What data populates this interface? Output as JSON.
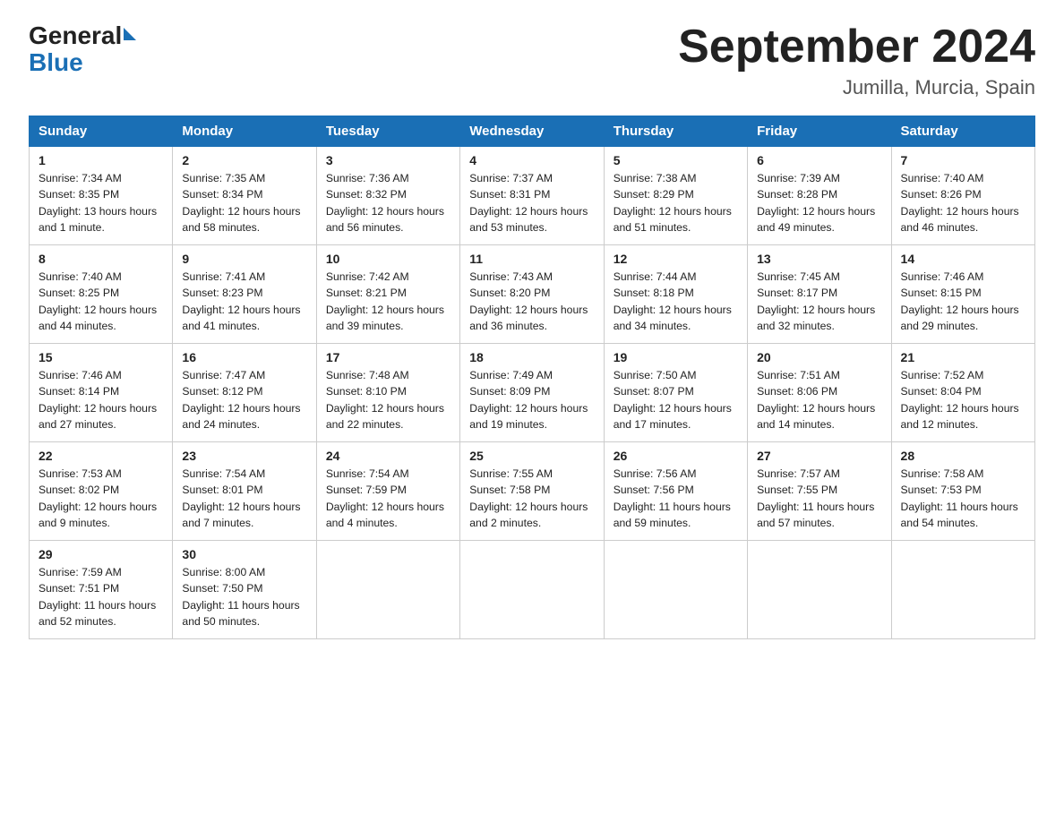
{
  "logo": {
    "general": "General",
    "blue": "Blue"
  },
  "title": "September 2024",
  "subtitle": "Jumilla, Murcia, Spain",
  "days_of_week": [
    "Sunday",
    "Monday",
    "Tuesday",
    "Wednesday",
    "Thursday",
    "Friday",
    "Saturday"
  ],
  "weeks": [
    [
      {
        "num": "1",
        "sunrise": "7:34 AM",
        "sunset": "8:35 PM",
        "daylight": "13 hours and 1 minute."
      },
      {
        "num": "2",
        "sunrise": "7:35 AM",
        "sunset": "8:34 PM",
        "daylight": "12 hours and 58 minutes."
      },
      {
        "num": "3",
        "sunrise": "7:36 AM",
        "sunset": "8:32 PM",
        "daylight": "12 hours and 56 minutes."
      },
      {
        "num": "4",
        "sunrise": "7:37 AM",
        "sunset": "8:31 PM",
        "daylight": "12 hours and 53 minutes."
      },
      {
        "num": "5",
        "sunrise": "7:38 AM",
        "sunset": "8:29 PM",
        "daylight": "12 hours and 51 minutes."
      },
      {
        "num": "6",
        "sunrise": "7:39 AM",
        "sunset": "8:28 PM",
        "daylight": "12 hours and 49 minutes."
      },
      {
        "num": "7",
        "sunrise": "7:40 AM",
        "sunset": "8:26 PM",
        "daylight": "12 hours and 46 minutes."
      }
    ],
    [
      {
        "num": "8",
        "sunrise": "7:40 AM",
        "sunset": "8:25 PM",
        "daylight": "12 hours and 44 minutes."
      },
      {
        "num": "9",
        "sunrise": "7:41 AM",
        "sunset": "8:23 PM",
        "daylight": "12 hours and 41 minutes."
      },
      {
        "num": "10",
        "sunrise": "7:42 AM",
        "sunset": "8:21 PM",
        "daylight": "12 hours and 39 minutes."
      },
      {
        "num": "11",
        "sunrise": "7:43 AM",
        "sunset": "8:20 PM",
        "daylight": "12 hours and 36 minutes."
      },
      {
        "num": "12",
        "sunrise": "7:44 AM",
        "sunset": "8:18 PM",
        "daylight": "12 hours and 34 minutes."
      },
      {
        "num": "13",
        "sunrise": "7:45 AM",
        "sunset": "8:17 PM",
        "daylight": "12 hours and 32 minutes."
      },
      {
        "num": "14",
        "sunrise": "7:46 AM",
        "sunset": "8:15 PM",
        "daylight": "12 hours and 29 minutes."
      }
    ],
    [
      {
        "num": "15",
        "sunrise": "7:46 AM",
        "sunset": "8:14 PM",
        "daylight": "12 hours and 27 minutes."
      },
      {
        "num": "16",
        "sunrise": "7:47 AM",
        "sunset": "8:12 PM",
        "daylight": "12 hours and 24 minutes."
      },
      {
        "num": "17",
        "sunrise": "7:48 AM",
        "sunset": "8:10 PM",
        "daylight": "12 hours and 22 minutes."
      },
      {
        "num": "18",
        "sunrise": "7:49 AM",
        "sunset": "8:09 PM",
        "daylight": "12 hours and 19 minutes."
      },
      {
        "num": "19",
        "sunrise": "7:50 AM",
        "sunset": "8:07 PM",
        "daylight": "12 hours and 17 minutes."
      },
      {
        "num": "20",
        "sunrise": "7:51 AM",
        "sunset": "8:06 PM",
        "daylight": "12 hours and 14 minutes."
      },
      {
        "num": "21",
        "sunrise": "7:52 AM",
        "sunset": "8:04 PM",
        "daylight": "12 hours and 12 minutes."
      }
    ],
    [
      {
        "num": "22",
        "sunrise": "7:53 AM",
        "sunset": "8:02 PM",
        "daylight": "12 hours and 9 minutes."
      },
      {
        "num": "23",
        "sunrise": "7:54 AM",
        "sunset": "8:01 PM",
        "daylight": "12 hours and 7 minutes."
      },
      {
        "num": "24",
        "sunrise": "7:54 AM",
        "sunset": "7:59 PM",
        "daylight": "12 hours and 4 minutes."
      },
      {
        "num": "25",
        "sunrise": "7:55 AM",
        "sunset": "7:58 PM",
        "daylight": "12 hours and 2 minutes."
      },
      {
        "num": "26",
        "sunrise": "7:56 AM",
        "sunset": "7:56 PM",
        "daylight": "11 hours and 59 minutes."
      },
      {
        "num": "27",
        "sunrise": "7:57 AM",
        "sunset": "7:55 PM",
        "daylight": "11 hours and 57 minutes."
      },
      {
        "num": "28",
        "sunrise": "7:58 AM",
        "sunset": "7:53 PM",
        "daylight": "11 hours and 54 minutes."
      }
    ],
    [
      {
        "num": "29",
        "sunrise": "7:59 AM",
        "sunset": "7:51 PM",
        "daylight": "11 hours and 52 minutes."
      },
      {
        "num": "30",
        "sunrise": "8:00 AM",
        "sunset": "7:50 PM",
        "daylight": "11 hours and 50 minutes."
      },
      null,
      null,
      null,
      null,
      null
    ]
  ],
  "labels": {
    "sunrise": "Sunrise:",
    "sunset": "Sunset:",
    "daylight": "Daylight:"
  }
}
